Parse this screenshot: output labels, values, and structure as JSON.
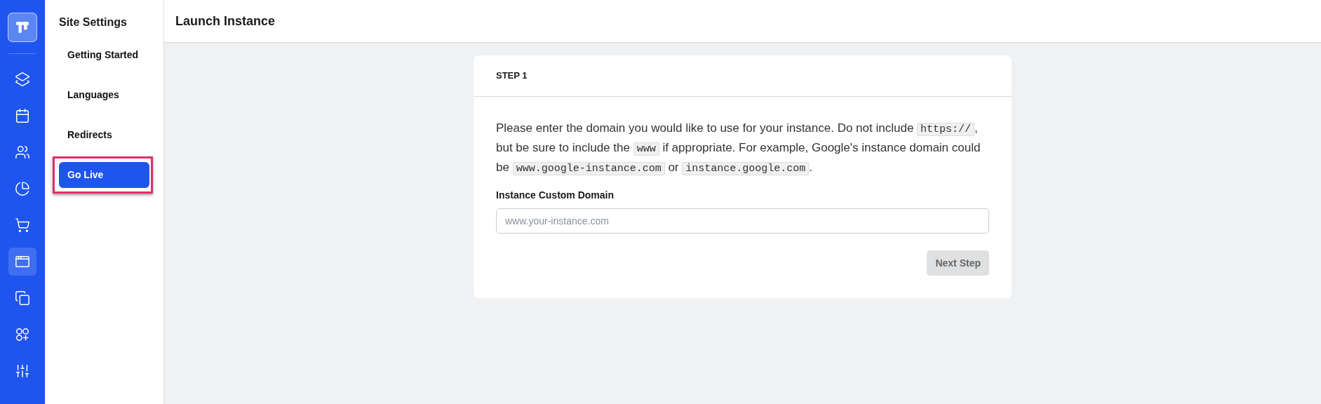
{
  "rail": {
    "items": [
      {
        "selected": false
      },
      {
        "selected": false
      },
      {
        "selected": false
      },
      {
        "selected": false
      },
      {
        "selected": false
      },
      {
        "selected": true
      },
      {
        "selected": false
      },
      {
        "selected": false
      },
      {
        "selected": false
      }
    ]
  },
  "sidebar": {
    "title": "Site Settings",
    "items": [
      {
        "label": "Getting Started",
        "selected": false,
        "highlighted": false
      },
      {
        "label": "Languages",
        "selected": false,
        "highlighted": false
      },
      {
        "label": "Redirects",
        "selected": false,
        "highlighted": false
      },
      {
        "label": "Go Live",
        "selected": true,
        "highlighted": true
      }
    ]
  },
  "header": {
    "title": "Launch Instance"
  },
  "card": {
    "step": "STEP 1",
    "description": [
      {
        "kind": "text",
        "text": "Please enter the domain you would like to use for your instance. Do not include "
      },
      {
        "kind": "code",
        "text": "https://"
      },
      {
        "kind": "text",
        "text": ", but be sure to include the "
      },
      {
        "kind": "code",
        "text": "www"
      },
      {
        "kind": "text",
        "text": " if appropriate. For example, Google's instance domain could be "
      },
      {
        "kind": "code",
        "text": "www.google-instance.com"
      },
      {
        "kind": "text",
        "text": " or "
      },
      {
        "kind": "code",
        "text": "instance.google.com"
      },
      {
        "kind": "text",
        "text": "."
      }
    ],
    "field": {
      "label": "Instance Custom Domain",
      "placeholder": "www.your-instance.com"
    },
    "button": {
      "label": "Next Step",
      "disabled": true
    }
  }
}
